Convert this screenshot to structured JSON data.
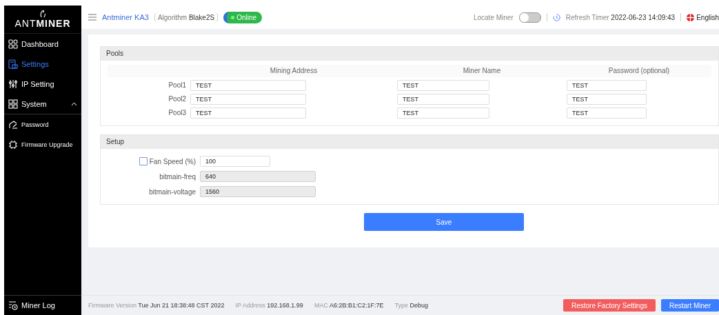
{
  "sidebar": {
    "logo": "ANTMINER",
    "items": [
      {
        "label": "Dashboard",
        "selected": false
      },
      {
        "label": "Settings",
        "selected": true
      },
      {
        "label": "IP Setting",
        "selected": false
      },
      {
        "label": "System",
        "selected": false,
        "expanded": true,
        "children": [
          {
            "label": "Password",
            "selected": false
          },
          {
            "label": "Firmware Upgrade",
            "selected": false
          }
        ]
      }
    ],
    "footer": {
      "label": "Miner Log"
    }
  },
  "header": {
    "title": "Antminer KA3",
    "algorithm_label": "Algorithm",
    "algorithm": "Blake2S",
    "status": "Online",
    "locate_label": "Locate Miner",
    "locate_on": false,
    "refresh_label": "Refresh Timer",
    "time": "2022-06-23 14:09:43",
    "language": "English"
  },
  "pools": {
    "title": "Pools",
    "columns": [
      "Mining Address",
      "Miner Name",
      "Password (optional)"
    ],
    "rows": [
      {
        "label": "Pool1",
        "values": [
          "TEST",
          "TEST",
          "TEST"
        ]
      },
      {
        "label": "Pool2",
        "values": [
          "TEST",
          "TEST",
          "TEST"
        ]
      },
      {
        "label": "Pool3",
        "values": [
          "TEST",
          "TEST",
          "TEST"
        ]
      }
    ]
  },
  "setup": {
    "title": "Setup",
    "fields": [
      {
        "kind": "checkbox",
        "label": "Fan Speed (%)",
        "checked": false,
        "value": "100",
        "disabled": false
      },
      {
        "kind": "plain",
        "label": "bitmain-freq",
        "value": "640",
        "disabled": true
      },
      {
        "kind": "plain",
        "label": "bitmain-voltage",
        "value": "1560",
        "disabled": true
      }
    ]
  },
  "save": "Save",
  "status_bar": [
    {
      "label": "Firmware Version",
      "value": "Tue Jun 21 18:38:48 CST 2022"
    },
    {
      "label": "IP Address",
      "value": "192.168.1.99"
    },
    {
      "label": "MAC",
      "value": "A6:2B:B1:C2:1F:7E"
    },
    {
      "label": "Type",
      "value": "Debug"
    }
  ],
  "buttons": [
    {
      "label": "Restore Factory Settings",
      "kind": "danger"
    },
    {
      "label": "Restart Miner",
      "kind": "primary"
    }
  ]
}
